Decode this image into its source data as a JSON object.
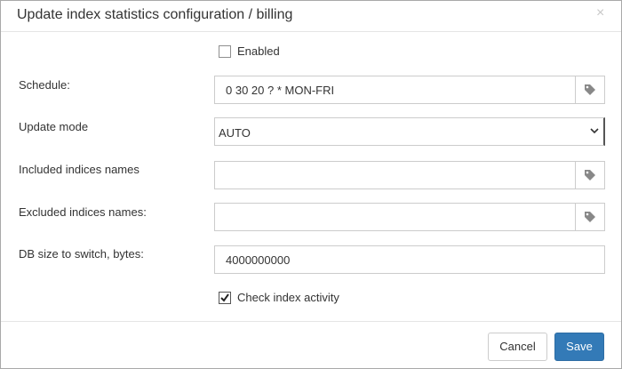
{
  "dialog": {
    "title": "Update index statistics configuration / billing",
    "close_glyph": "×"
  },
  "form": {
    "enabled": {
      "label": "Enabled",
      "checked": false
    },
    "schedule": {
      "label": "Schedule:",
      "value": "0 30 20 ? * MON-FRI",
      "icon": "tag-icon"
    },
    "update_mode": {
      "label": "Update mode",
      "selected": "AUTO",
      "icon": "chevron-down-icon"
    },
    "included": {
      "label": "Included indices names",
      "value": "",
      "icon": "tag-icon"
    },
    "excluded": {
      "label": "Excluded indices names:",
      "value": "",
      "icon": "tag-icon"
    },
    "db_size": {
      "label": "DB size to switch, bytes:",
      "value": "4000000000"
    },
    "check_activity": {
      "label": "Check index activity",
      "checked": true
    }
  },
  "footer": {
    "cancel_label": "Cancel",
    "save_label": "Save"
  },
  "colors": {
    "primary": "#337ab7",
    "border": "#cccccc",
    "text": "#333333"
  }
}
